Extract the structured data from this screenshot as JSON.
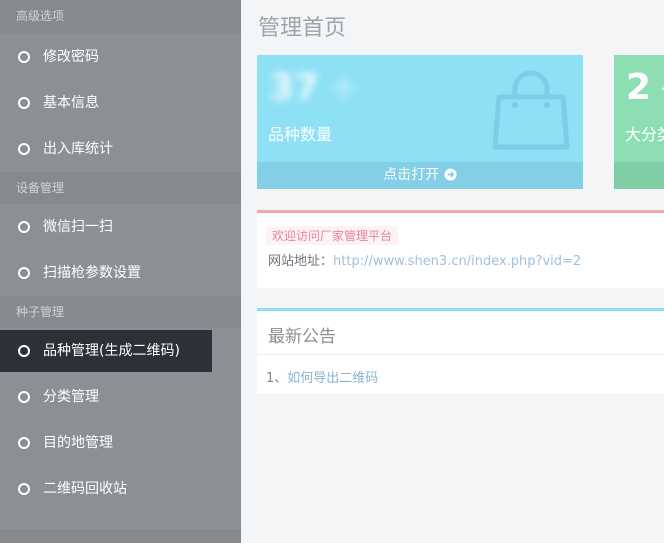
{
  "sidebar": {
    "sections": [
      {
        "title": "高级选项",
        "items": [
          {
            "label": "修改密码"
          },
          {
            "label": "基本信息"
          },
          {
            "label": "出入库统计"
          }
        ]
      },
      {
        "title": "设备管理",
        "items": [
          {
            "label": "微信扫一扫"
          },
          {
            "label": "扫描枪参数设置"
          }
        ]
      },
      {
        "title": "种子管理",
        "items": [
          {
            "label": "品种管理(生成二维码)",
            "active": true
          },
          {
            "label": "分类管理"
          },
          {
            "label": "目的地管理"
          },
          {
            "label": "二维码回收站"
          }
        ]
      }
    ]
  },
  "main": {
    "title": "管理首页",
    "cards": [
      {
        "number": "37",
        "unit": "个",
        "label": "品种数量",
        "footer": "点击打开",
        "color": "#8ee0f5",
        "icon": "shopping-bag-icon"
      },
      {
        "number": "2",
        "unit": "个",
        "label": "大分类",
        "color": "#8edeb4"
      }
    ],
    "welcome": {
      "tag": "欢迎访问厂家管理平台",
      "site_label": "网站地址：",
      "site_url": "http://www.shen3.cn/index.php?vid=2"
    },
    "notice": {
      "title": "最新公告",
      "items": [
        {
          "index": "1、",
          "text": "如何导出二维码"
        }
      ]
    }
  }
}
